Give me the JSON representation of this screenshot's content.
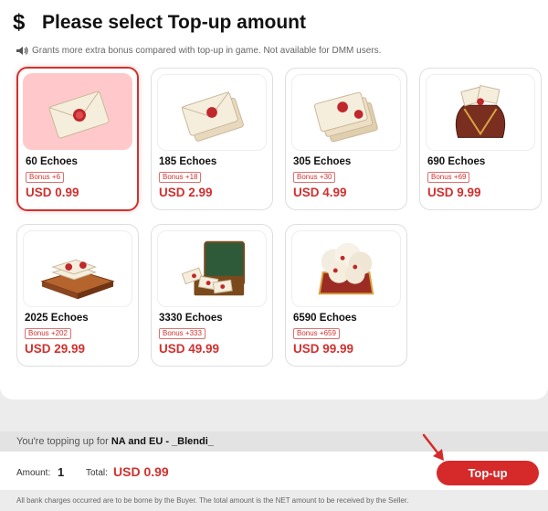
{
  "header": {
    "currency_symbol": "$",
    "title": "Please select Top-up amount",
    "notice": "Grants more extra bonus compared with top-up in game. Not available for DMM users."
  },
  "packages": [
    {
      "name": "60 Echoes",
      "bonus": "Bonus +6",
      "price": "USD 0.99",
      "icon": "envelope-icon",
      "selected": true
    },
    {
      "name": "185 Echoes",
      "bonus": "Bonus +18",
      "price": "USD 2.99",
      "icon": "envelope-stack-icon"
    },
    {
      "name": "305 Echoes",
      "bonus": "Bonus +30",
      "price": "USD 4.99",
      "icon": "envelope-pile-icon"
    },
    {
      "name": "690 Echoes",
      "bonus": "Bonus +69",
      "price": "USD 9.99",
      "icon": "envelope-bag-icon"
    },
    {
      "name": "2025 Echoes",
      "bonus": "Bonus +202",
      "price": "USD 29.99",
      "icon": "envelope-tray-icon"
    },
    {
      "name": "3330 Echoes",
      "bonus": "Bonus +333",
      "price": "USD 49.99",
      "icon": "envelope-suitcase-icon"
    },
    {
      "name": "6590 Echoes",
      "bonus": "Bonus +659",
      "price": "USD 99.99",
      "icon": "envelope-chest-icon"
    }
  ],
  "checkout": {
    "topping_prefix": "You're topping up for",
    "account": "NA and EU - _Blendi_",
    "amount_label": "Amount:",
    "amount_value": "1",
    "total_label": "Total:",
    "total_value": "USD 0.99",
    "topup_label": "Top-up",
    "footer": "All bank charges occurred are to be borne by the Buyer. The total amount is the NET amount to be received by the Seller."
  },
  "colors": {
    "accent": "#d0312f",
    "selected_bg": "#ffc9cb"
  }
}
